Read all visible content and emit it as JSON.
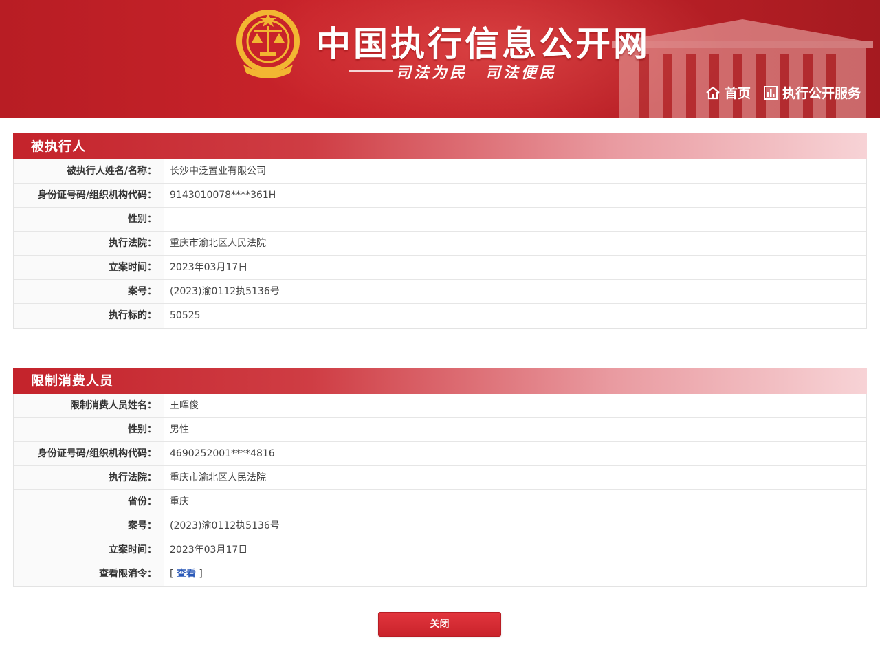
{
  "header": {
    "site_title": "中国执行信息公开网",
    "slogan_dash": "——",
    "slogan": "司法为民　司法便民",
    "nav": [
      {
        "label": "首页",
        "icon": "home-icon"
      },
      {
        "label": "执行公开服务",
        "icon": "chart-icon"
      }
    ]
  },
  "executee": {
    "title": "被执行人",
    "rows": [
      {
        "label": "被执行人姓名/名称：",
        "value": "长沙中泛置业有限公司"
      },
      {
        "label": "身份证号码/组织机构代码：",
        "value": "9143010078****361H"
      },
      {
        "label": "性别：",
        "value": ""
      },
      {
        "label": "执行法院：",
        "value": "重庆市渝北区人民法院"
      },
      {
        "label": "立案时间：",
        "value": "2023年03月17日"
      },
      {
        "label": "案号：",
        "value": "(2023)渝0112执5136号"
      },
      {
        "label": "执行标的：",
        "value": "50525"
      }
    ]
  },
  "restricted": {
    "title": "限制消费人员",
    "rows": [
      {
        "label": "限制消费人员姓名：",
        "value": "王晖俊"
      },
      {
        "label": "性别：",
        "value": "男性"
      },
      {
        "label": "身份证号码/组织机构代码：",
        "value": "4690252001****4816"
      },
      {
        "label": "执行法院：",
        "value": "重庆市渝北区人民法院"
      },
      {
        "label": "省份：",
        "value": "重庆"
      },
      {
        "label": "案号：",
        "value": "(2023)渝0112执5136号"
      },
      {
        "label": "立案时间：",
        "value": "2023年03月17日"
      },
      {
        "label": "查看限消令：",
        "value_prefix": "[ ",
        "link": "查看",
        "value_suffix": " ]"
      }
    ]
  },
  "close_button": {
    "label": "关闭"
  },
  "colors": {
    "brand_red": "#c8232a",
    "link_blue": "#2a59b8"
  }
}
